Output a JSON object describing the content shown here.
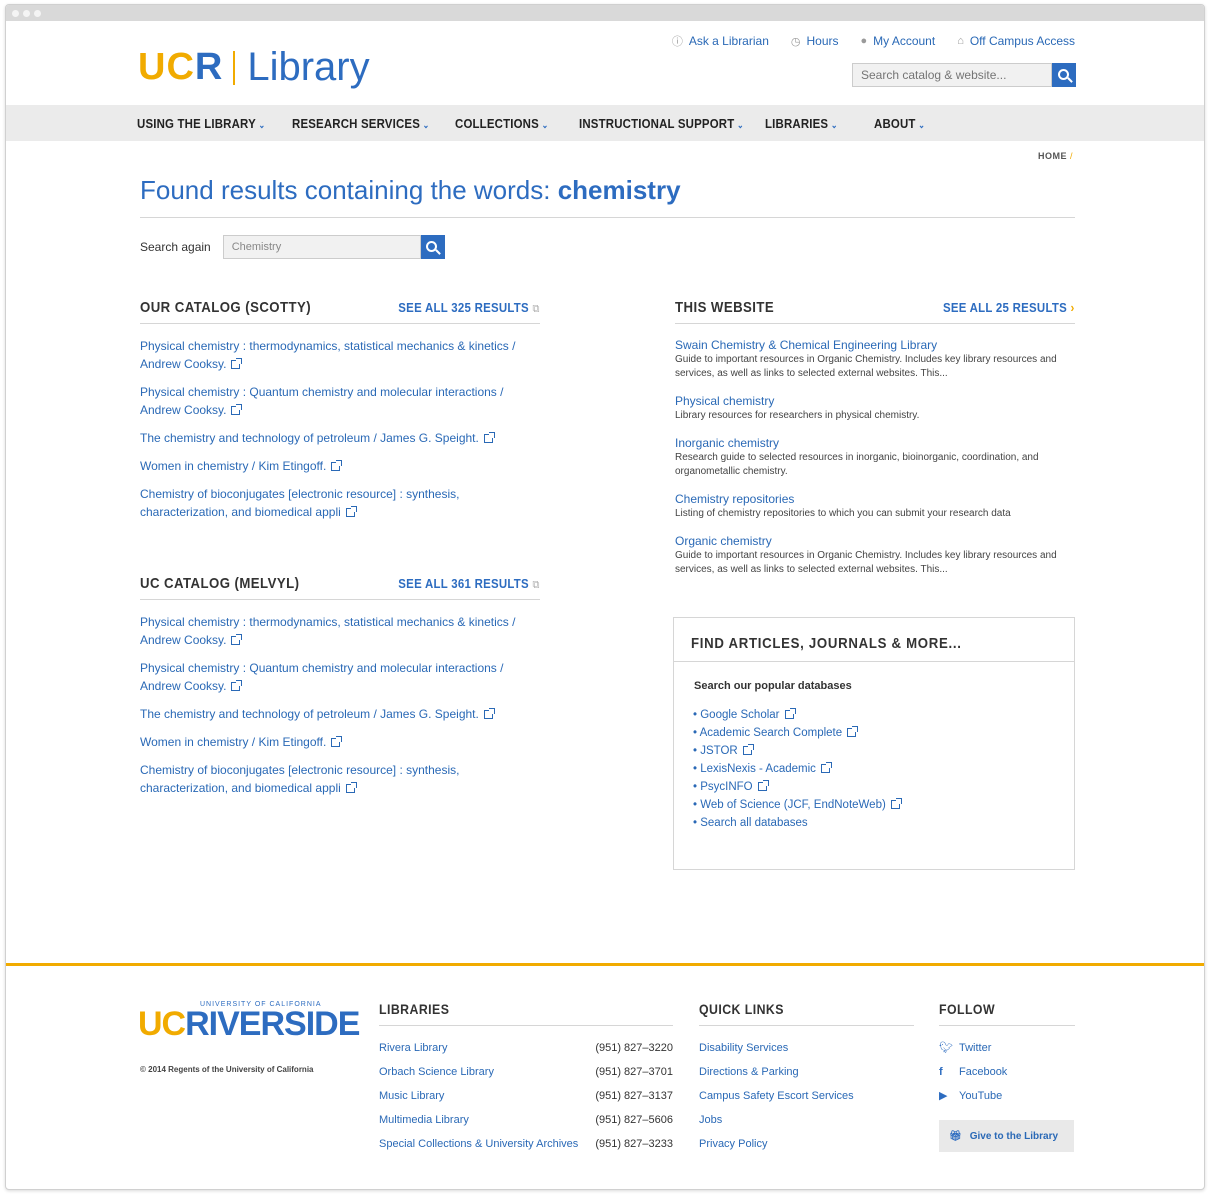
{
  "header": {
    "logo_ucr_a": "UC",
    "logo_ucr_b": "R",
    "logo_library": "Library",
    "utility": [
      {
        "label": "Ask a Librarian",
        "icon": "info-icon"
      },
      {
        "label": "Hours",
        "icon": "clock-icon"
      },
      {
        "label": "My Account",
        "icon": "user-icon"
      },
      {
        "label": "Off Campus Access",
        "icon": "home-icon"
      }
    ],
    "search_placeholder": "Search catalog & website..."
  },
  "nav": [
    "USING THE LIBRARY",
    "RESEARCH SERVICES",
    "COLLECTIONS",
    "INSTRUCTIONAL SUPPORT",
    "LIBRARIES",
    "ABOUT"
  ],
  "breadcrumb": "HOME",
  "title_prefix": "Found results containing the words: ",
  "title_term": "chemistry",
  "search_again": {
    "label": "Search again",
    "value": "Chemistry"
  },
  "scotty": {
    "heading": "OUR CATALOG (SCOTTY)",
    "see_all": "SEE ALL 325 RESULTS",
    "results": [
      "Physical chemistry : thermodynamics, statistical mechanics & kinetics / Andrew Cooksy.",
      "Physical chemistry : Quantum chemistry and molecular interactions / Andrew Cooksy.",
      "The chemistry and technology of petroleum / James G. Speight.",
      "Women in chemistry / Kim Etingoff.",
      "Chemistry of bioconjugates [electronic resource] : synthesis, characterization, and biomedical appli"
    ]
  },
  "melvyl": {
    "heading": "UC CATALOG (MELVYL)",
    "see_all": "SEE ALL 361 RESULTS",
    "results": [
      "Physical chemistry : thermodynamics, statistical mechanics & kinetics / Andrew Cooksy.",
      "Physical chemistry : Quantum chemistry and molecular interactions / Andrew Cooksy.",
      "The chemistry and technology of petroleum / James G. Speight.",
      "Women in chemistry / Kim Etingoff.",
      "Chemistry of bioconjugates [electronic resource] : synthesis, characterization, and biomedical appli"
    ]
  },
  "website": {
    "heading": "THIS WEBSITE",
    "see_all": "SEE ALL 25 RESULTS",
    "results": [
      {
        "title": "Swain Chemistry & Chemical Engineering Library",
        "desc": "Guide to important resources in Organic Chemistry. Includes key library resources and services, as well as links to selected external websites.  This..."
      },
      {
        "title": "Physical chemistry",
        "desc": "Library resources for researchers in physical chemistry."
      },
      {
        "title": "Inorganic chemistry",
        "desc": "Research guide to selected resources in inorganic, bioinorganic, coordination, and organometallic chemistry."
      },
      {
        "title": "Chemistry repositories",
        "desc": "Listing of chemistry repositories to which you can submit your research data"
      },
      {
        "title": "Organic chemistry",
        "desc": "Guide to important resources in Organic Chemistry. Includes key library resources and services, as well as links to selected external websites.  This..."
      }
    ]
  },
  "articles_box": {
    "heading": "FIND ARTICLES, JOURNALS & MORE...",
    "subheading": "Search our popular databases",
    "databases": [
      "Google Scholar",
      "Academic Search Complete",
      "JSTOR",
      "LexisNexis - Academic",
      "PsycINFO",
      "Web of Science (JCF, EndNoteWeb)",
      "Search all databases"
    ]
  },
  "footer": {
    "logo_small": "UNIVERSITY OF CALIFORNIA",
    "logo_uc": "UC",
    "logo_riverside": "RIVERSIDE",
    "copyright": "© 2014 Regents of the University of California",
    "libraries_heading": "LIBRARIES",
    "libraries": [
      {
        "name": "Rivera Library",
        "phone": "(951) 827–3220"
      },
      {
        "name": "Orbach Science Library",
        "phone": "(951) 827–3701"
      },
      {
        "name": "Music Library",
        "phone": "(951) 827–3137"
      },
      {
        "name": "Multimedia Library",
        "phone": "(951) 827–5606"
      },
      {
        "name": "Special Collections & University Archives",
        "phone": "(951) 827–3233"
      }
    ],
    "quick_heading": "QUICK LINKS",
    "quick_links": [
      "Disability Services",
      "Directions & Parking",
      "Campus Safety Escort Services",
      "Jobs",
      "Privacy Policy"
    ],
    "follow_heading": "FOLLOW",
    "follow": [
      {
        "label": "Twitter",
        "icon": "twitter-icon"
      },
      {
        "label": "Facebook",
        "icon": "facebook-icon"
      },
      {
        "label": "YouTube",
        "icon": "youtube-icon"
      }
    ],
    "give": "Give to the Library"
  },
  "colors": {
    "brand_blue": "#2d6cc0",
    "brand_gold": "#f1ab00",
    "nav_bg": "#ebebeb"
  }
}
